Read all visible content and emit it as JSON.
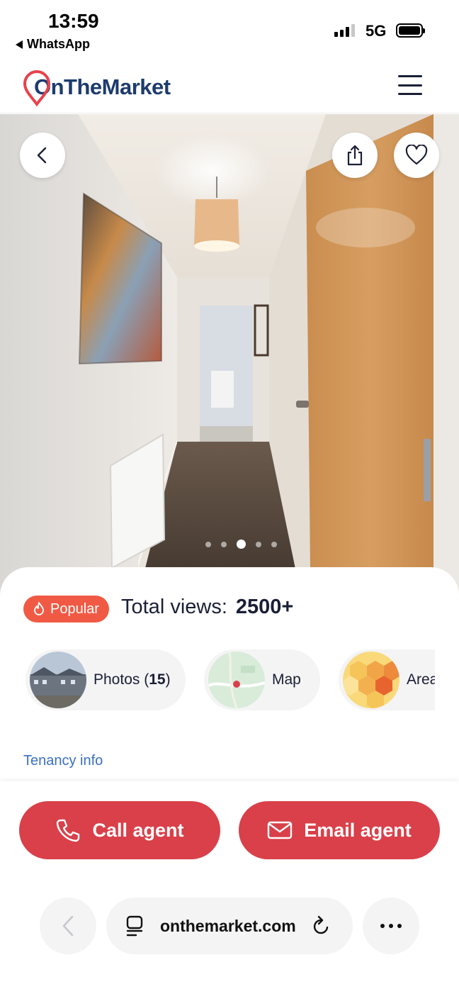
{
  "status_bar": {
    "time": "13:59",
    "back_app": "WhatsApp",
    "network": "5G"
  },
  "header": {
    "brand": "OnTheMarket",
    "menu_icon": "hamburger-menu-icon"
  },
  "gallery": {
    "back_icon": "chevron-left-icon",
    "share_icon": "share-icon",
    "favourite_icon": "heart-icon",
    "slides": 5,
    "active_slide": 3
  },
  "stats": {
    "badge_label": "Popular",
    "badge_icon": "flame-icon",
    "views_label": "Total views:",
    "views_value": "2500+"
  },
  "media_chips": {
    "photos_label": "Photos (",
    "photos_count": "15",
    "photos_close": ")",
    "map_label": "Map",
    "area_label": "Area"
  },
  "tenancy_link": "Tenancy info",
  "actions": {
    "call_label": "Call agent",
    "email_label": "Email agent"
  },
  "browser": {
    "url": "onthemarket.com"
  },
  "colors": {
    "brand_navy": "#1d3b6e",
    "brand_red": "#d94049",
    "popular_orange": "#f05a44",
    "link_blue": "#3b6fc4"
  }
}
